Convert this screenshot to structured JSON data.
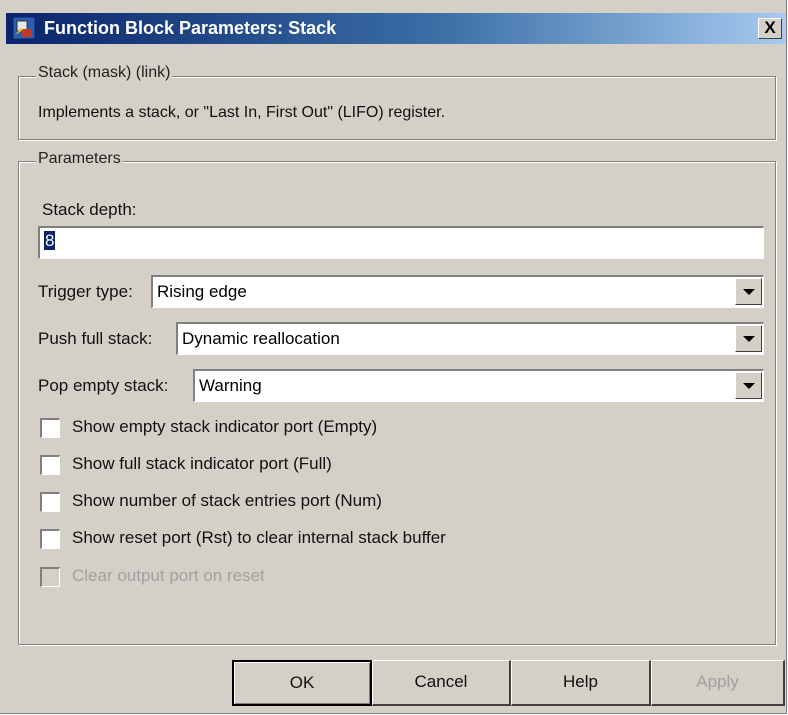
{
  "window": {
    "title": "Function Block Parameters: Stack",
    "close_label": "X",
    "colors": {
      "titlebar_start": "#0a246a",
      "titlebar_end": "#a6caf0",
      "face": "#d4d0c8"
    }
  },
  "mask_group": {
    "legend": "Stack (mask) (link)",
    "description": "Implements a stack, or \"Last In, First Out\" (LIFO) register."
  },
  "parameters": {
    "legend": "Parameters",
    "stack_depth": {
      "label": "Stack depth:",
      "value": "8"
    },
    "trigger_type": {
      "label": "Trigger type:",
      "value": "Rising edge"
    },
    "push_full_stack": {
      "label": "Push full stack:",
      "value": "Dynamic reallocation"
    },
    "pop_empty_stack": {
      "label": "Pop empty stack:",
      "value": "Warning"
    },
    "checkboxes": [
      {
        "label": "Show empty stack indicator port (Empty)",
        "checked": false,
        "enabled": true
      },
      {
        "label": "Show full stack indicator port (Full)",
        "checked": false,
        "enabled": true
      },
      {
        "label": "Show number of stack entries port (Num)",
        "checked": false,
        "enabled": true
      },
      {
        "label": "Show reset port (Rst) to clear internal stack buffer",
        "checked": false,
        "enabled": true
      },
      {
        "label": "Clear output port on reset",
        "checked": false,
        "enabled": false
      }
    ]
  },
  "buttons": {
    "ok": "OK",
    "cancel": "Cancel",
    "help": "Help",
    "apply": "Apply"
  }
}
